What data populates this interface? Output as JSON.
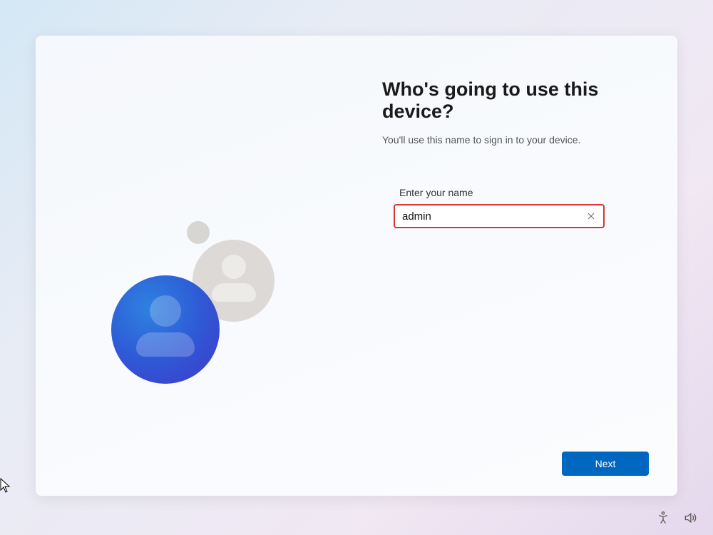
{
  "heading": "Who's going to use this device?",
  "subheading": "You'll use this name to sign in to your device.",
  "field_label": "Enter your name",
  "name_input": {
    "value": "admin",
    "placeholder": ""
  },
  "next_button_label": "Next",
  "colors": {
    "primary": "#0067c0",
    "error_border": "#dd3333"
  }
}
